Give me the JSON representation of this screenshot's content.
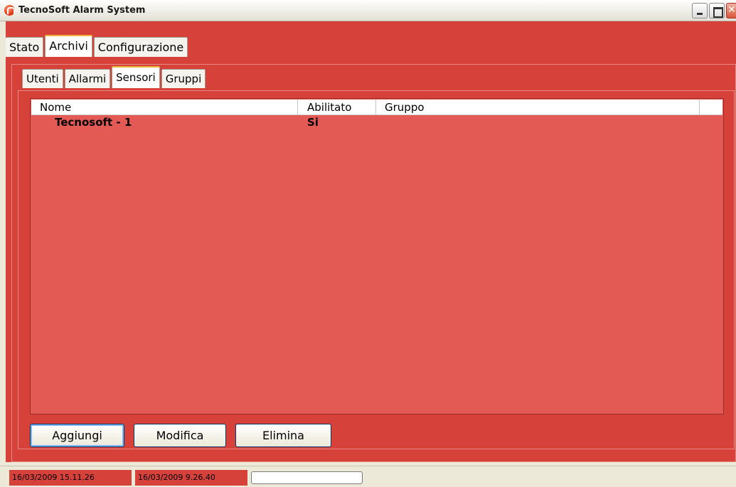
{
  "window": {
    "title": "TecnoSoft Alarm System"
  },
  "main_tabs": [
    {
      "label": "Stato",
      "active": false
    },
    {
      "label": "Archivi",
      "active": true
    },
    {
      "label": "Configurazione",
      "active": false
    }
  ],
  "sub_tabs": [
    {
      "label": "Utenti",
      "active": false
    },
    {
      "label": "Allarmi",
      "active": false
    },
    {
      "label": "Sensori",
      "active": true
    },
    {
      "label": "Gruppi",
      "active": false
    }
  ],
  "table": {
    "columns": [
      "Nome",
      "Abilitato",
      "Gruppo"
    ],
    "rows": [
      {
        "nome": "Tecnosoft - 1",
        "abilitato": "Si",
        "gruppo": ""
      }
    ]
  },
  "buttons": {
    "add": "Aggiungi",
    "edit": "Modifica",
    "delete": "Elimina"
  },
  "statusbar": {
    "time1": "16/03/2009 15.11.26",
    "time2": "16/03/2009 9.26.40"
  },
  "colors": {
    "accent": "#d6413a",
    "list_bg": "#e35a55",
    "active_tab_marker": "#f0b33b"
  },
  "icons": {
    "app": "alarm-bell-icon",
    "minimize": "minimize-icon",
    "maximize": "maximize-icon",
    "close": "close-icon"
  }
}
